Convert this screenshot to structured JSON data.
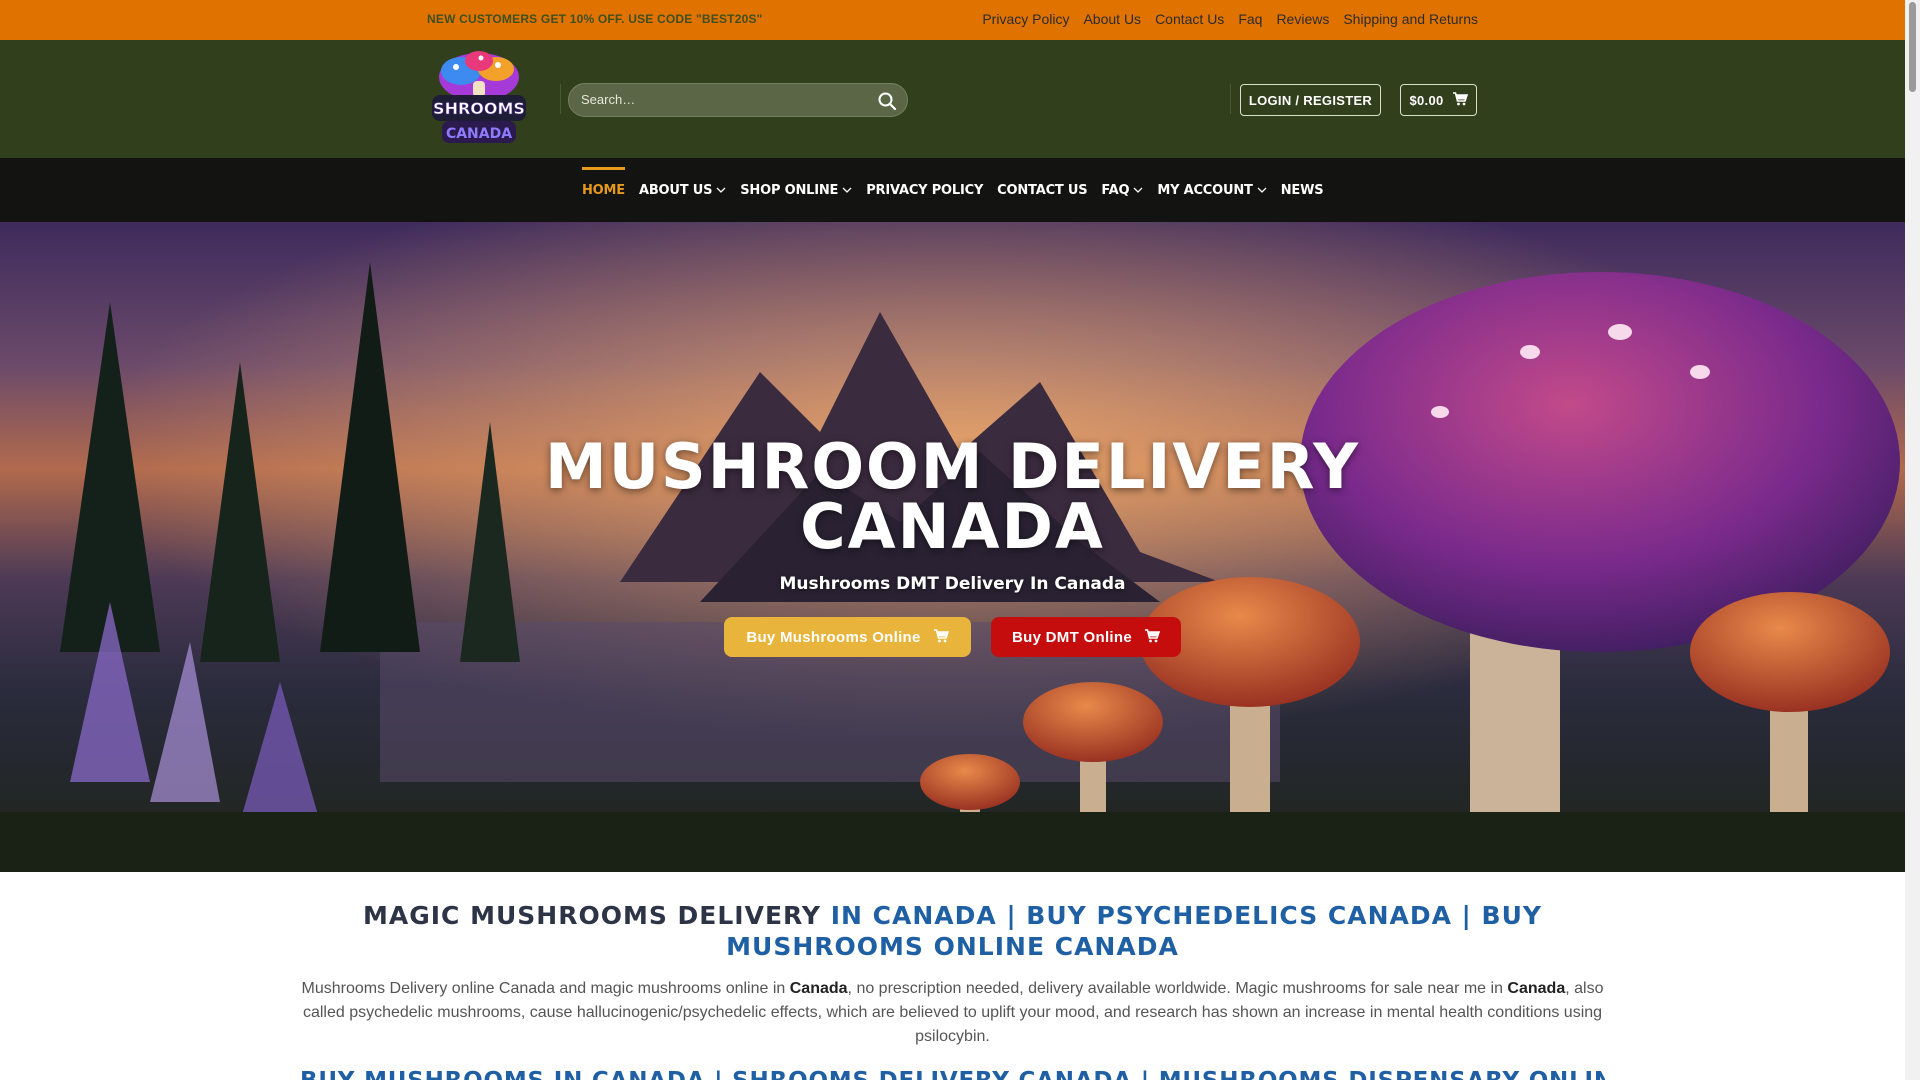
{
  "topbar": {
    "promo": "NEW CUSTOMERS GET 10% OFF. USE CODE \"BEST20S\"",
    "links": [
      "Privacy Policy",
      "About Us",
      "Contact Us",
      "Faq",
      "Reviews",
      "Shipping and Returns"
    ]
  },
  "header": {
    "logo_text": "SHROOMS CANADA",
    "search_placeholder": "Search…",
    "login_label": "LOGIN / REGISTER",
    "cart_total": "$0.00"
  },
  "nav": {
    "items": [
      {
        "label": "HOME",
        "active": true,
        "dropdown": false
      },
      {
        "label": "ABOUT US",
        "active": false,
        "dropdown": true
      },
      {
        "label": "SHOP ONLINE",
        "active": false,
        "dropdown": true
      },
      {
        "label": "PRIVACY POLICY",
        "active": false,
        "dropdown": false
      },
      {
        "label": "CONTACT US",
        "active": false,
        "dropdown": false
      },
      {
        "label": "FAQ",
        "active": false,
        "dropdown": true
      },
      {
        "label": "MY ACCOUNT",
        "active": false,
        "dropdown": true
      },
      {
        "label": "NEWS",
        "active": false,
        "dropdown": false
      }
    ]
  },
  "hero": {
    "title_line1": "MUSHROOM DELIVERY",
    "title_line2": "CANADA",
    "subtitle": "Mushrooms DMT Delivery In Canada",
    "btn_mushrooms": "Buy Mushrooms Online",
    "btn_dmt": "Buy DMT Online"
  },
  "content": {
    "heading_dark": "MAGIC MUSHROOMS DELIVERY",
    "heading_blue": "IN CANADA | BUY PSYCHEDELICS CANADA | BUY MUSHROOMS ONLINE CANADA",
    "para_1": "Mushrooms Delivery online Canada and magic mushrooms online in ",
    "para_bold_1": "Canada",
    "para_2": ", no prescription needed, delivery available worldwide. Magic mushrooms for sale near me in ",
    "para_bold_2": "Canada",
    "para_3": ", also called psychedelic mushrooms, cause hallucinogenic/psychedelic effects, which are believed to uplift your mood, and research has shown an increase in mental health conditions using psilocybin.",
    "heading2": "BUY MUSHROOMS IN CANADA | SHROOMS DELIVERY CANADA | MUSHROOMS DISPENSARY ONLINE"
  },
  "colors": {
    "topbar": "#e07300",
    "header": "#323f1d",
    "nav": "#131411",
    "accent": "#e69a1c",
    "btn_mushrooms": "#e9b43b",
    "btn_dmt": "#c60d0d",
    "heading_blue": "#1f5fa3"
  },
  "icons": {
    "search": "search-icon",
    "cart": "cart-icon",
    "dropdown": "chevron-down-icon"
  }
}
